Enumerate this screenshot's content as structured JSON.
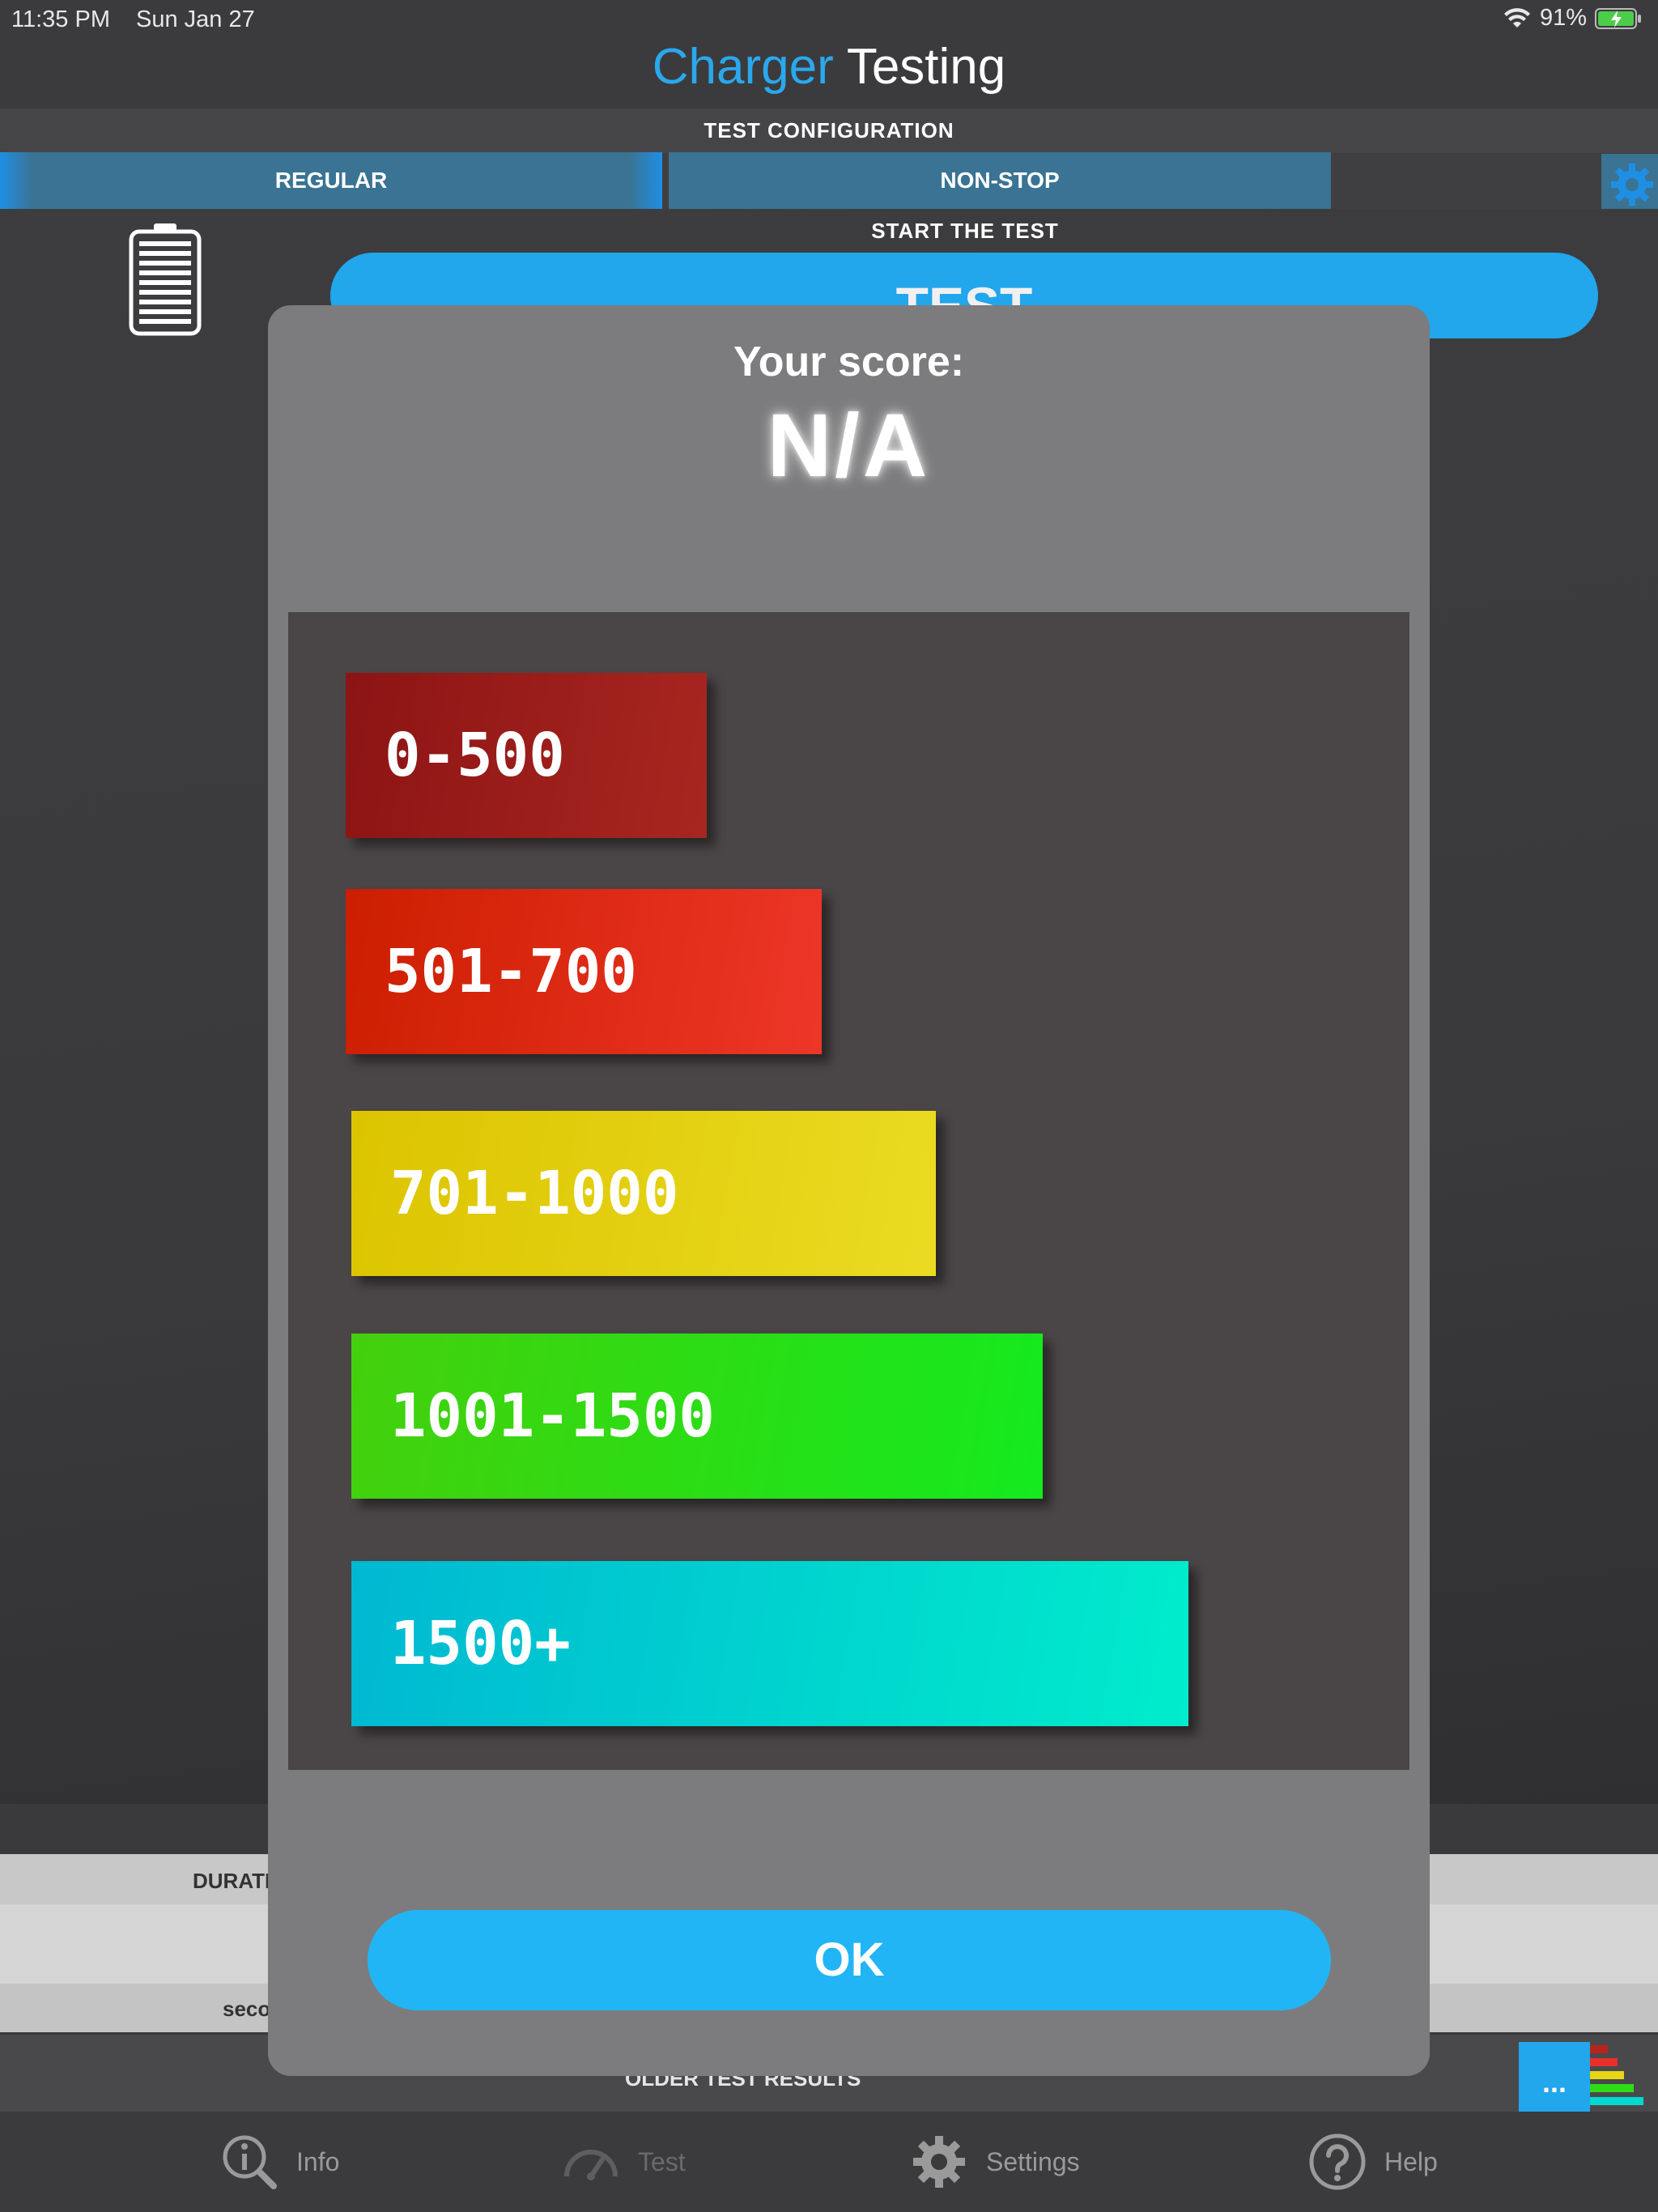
{
  "status_bar": {
    "time": "11:35 PM",
    "date": "Sun Jan 27",
    "battery": "91%"
  },
  "app": {
    "title_part1": "Charger",
    "title_part2": "Testing"
  },
  "config": {
    "label": "TEST CONFIGURATION",
    "tabs": [
      {
        "label": "REGULAR"
      },
      {
        "label": "NON-STOP"
      }
    ]
  },
  "start": {
    "label": "START THE TEST",
    "button": "TEST"
  },
  "results_table": {
    "duration_fragment": "DURATI",
    "seconds_fragment": "seco"
  },
  "older": {
    "label": "OLDER TEST RESULTS",
    "more_button": "..."
  },
  "modal": {
    "score_label": "Your score:",
    "score_value": "N/A",
    "bands": [
      {
        "label": "0-500",
        "color_start": "#8c1414",
        "color_end": "#a82620"
      },
      {
        "label": "501-700",
        "color_start": "#cc1e00",
        "color_end": "#ee3628"
      },
      {
        "label": "701-1000",
        "color_start": "#dcc400",
        "color_end": "#eadb22"
      },
      {
        "label": "1001-1500",
        "color_start": "#44d00c",
        "color_end": "#14ea1e"
      },
      {
        "label": "1500+",
        "color_start": "#00b8d2",
        "color_end": "#00eccc"
      }
    ],
    "ok_button": "OK"
  },
  "tab_bar": [
    {
      "label": "Info",
      "icon": "info-search-icon"
    },
    {
      "label": "Test",
      "icon": "speedometer-icon"
    },
    {
      "label": "Settings",
      "icon": "gear-icon"
    },
    {
      "label": "Help",
      "icon": "help-icon"
    }
  ],
  "colors": {
    "accent": "#22a6ec",
    "tab_active": "#3a7393",
    "modal_bg": "#7c7c7e",
    "panel_bg": "#4a4647"
  }
}
